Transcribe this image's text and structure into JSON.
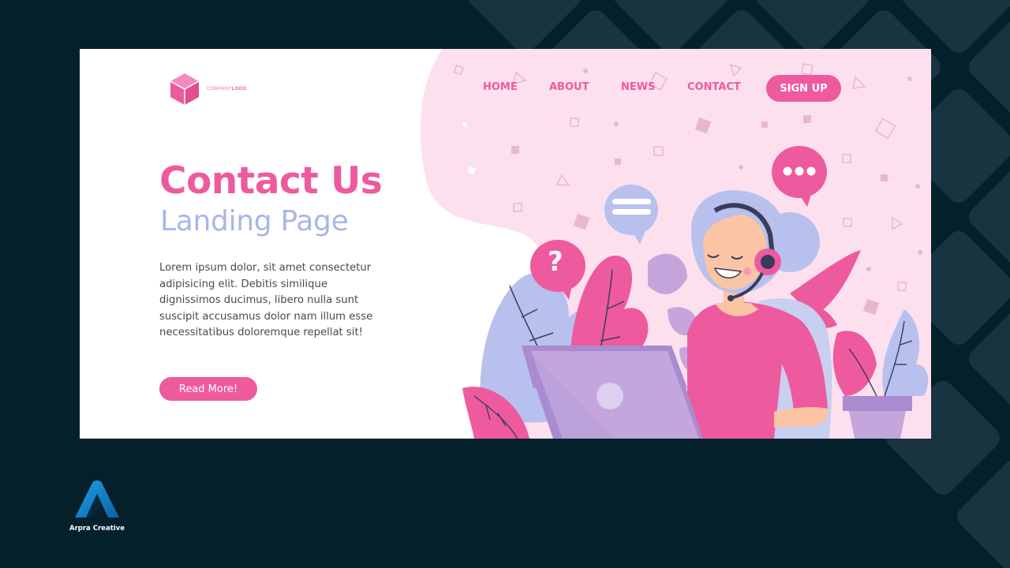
{
  "logo": {
    "text_main": "COMPANY",
    "text_accent": "LOGO"
  },
  "nav": {
    "items": [
      {
        "label": "HOME"
      },
      {
        "label": "ABOUT"
      },
      {
        "label": "NEWS"
      },
      {
        "label": "CONTACT"
      }
    ],
    "signup_label": "SIGN UP"
  },
  "hero": {
    "title": "Contact Us",
    "subtitle": "Landing Page",
    "body": "Lorem ipsum dolor, sit amet consectetur adipisicing elit. Debitis similique dignissimos ducimus, libero nulla sunt suscipit accusamus dolor nam illum esse necessitatibus doloremque repellat sit!",
    "button_label": "Read More!"
  },
  "illustration": {
    "bubble_question": "?",
    "icons": [
      "chat-bubble-lines-icon",
      "chat-bubble-dots-icon",
      "question-bubble-icon",
      "headset-icon",
      "laptop-icon"
    ]
  },
  "brand": {
    "name": "Arpra Creative"
  },
  "colors": {
    "page_bg": "#03202b",
    "pink": "#ee5a9e",
    "light_pink": "#fde0ee",
    "lavender": "#a9b6e8",
    "purple": "#c4a6dc"
  }
}
